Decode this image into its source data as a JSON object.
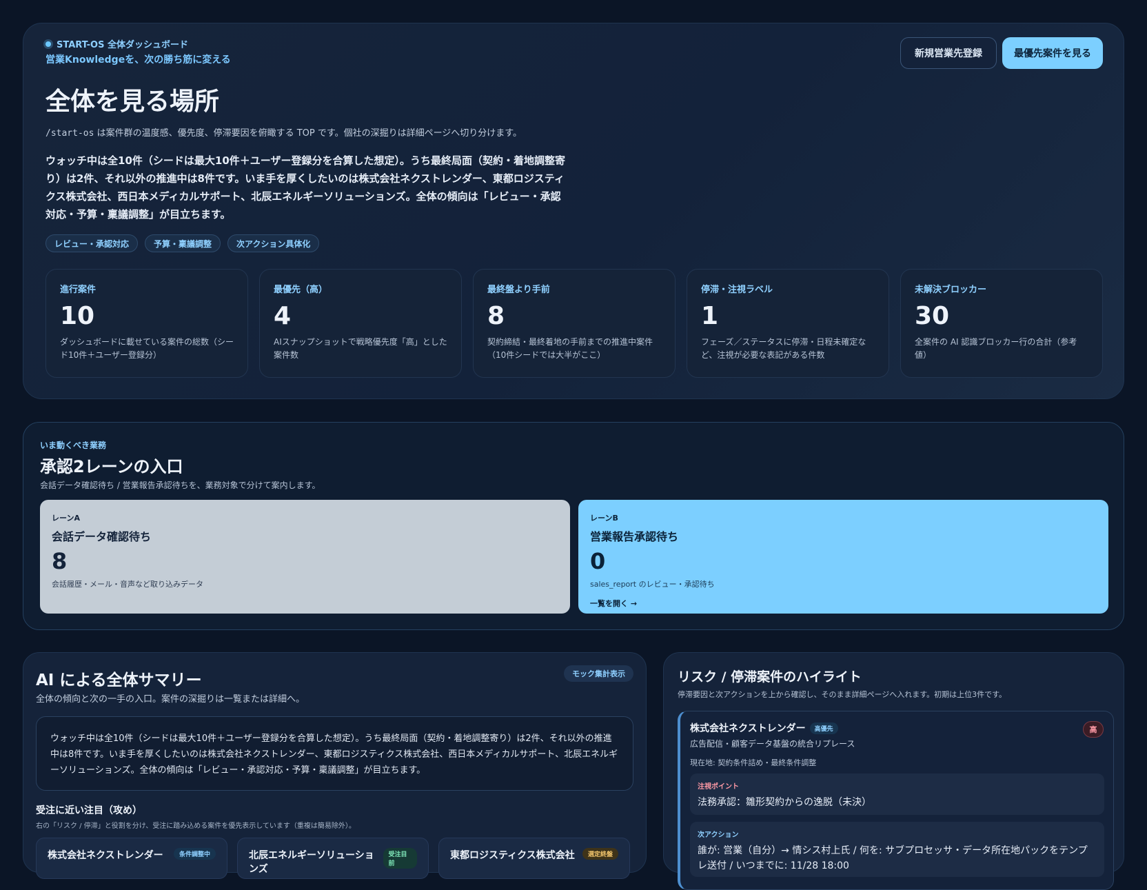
{
  "hero": {
    "eyebrow": "START-OS 全体ダッシュボード",
    "tagline": "営業Knowledgeを、次の勝ち筋に変える",
    "title": "全体を見る場所",
    "desc_code": "/start-os",
    "desc_rest": " は案件群の温度感、優先度、停滞要因を俯瞰する TOP です。個社の深掘りは詳細ページへ切り分けます。",
    "summary": "ウォッチ中は全10件（シードは最大10件＋ユーザー登録分を合算した想定）。うち最終局面（契約・着地調整寄り）は2件、それ以外の推進中は8件です。いま手を厚くしたいのは株式会社ネクストレンダー、東都ロジスティクス株式会社、西日本メディカルサポート、北辰エネルギーソリューションズ。全体の傾向は「レビュー・承認対応・予算・稟議調整」が目立ちます。",
    "chips": [
      "レビュー・承認対応",
      "予算・稟議調整",
      "次アクション具体化"
    ],
    "buttons": {
      "new_client": "新規営業先登録",
      "top_priority": "最優先案件を見る"
    },
    "stats": [
      {
        "label": "進行案件",
        "value": "10",
        "desc": "ダッシュボードに載せている案件の総数（シード10件＋ユーザー登録分）"
      },
      {
        "label": "最優先（高）",
        "value": "4",
        "desc": "AIスナップショットで戦略優先度「高」とした案件数"
      },
      {
        "label": "最終盤より手前",
        "value": "8",
        "desc": "契約締結・最終着地の手前までの推進中案件（10件シードでは大半がここ）"
      },
      {
        "label": "停滞・注視ラベル",
        "value": "1",
        "desc": "フェーズ／ステータスに停滞・日程未確定など、注視が必要な表記がある件数"
      },
      {
        "label": "未解決ブロッカー",
        "value": "30",
        "desc": "全案件の AI 認識ブロッカー行の合計（参考値）"
      }
    ]
  },
  "lanes": {
    "eyebrow": "いま動くべき業務",
    "title": "承認2レーンの入口",
    "desc": "会話データ確認待ち / 営業報告承認待ちを、業務対象で分けて案内します。",
    "lane_a": {
      "tag": "レーンA",
      "title": "会話データ確認待ち",
      "count": "8",
      "desc": "会話履歴・メール・音声など取り込みデータ"
    },
    "lane_b": {
      "tag": "レーンB",
      "title": "営業報告承認待ち",
      "count": "0",
      "desc": "sales_report のレビュー・承認待ち",
      "link": "一覧を開く →"
    }
  },
  "ai": {
    "title": "AI による全体サマリー",
    "sub": "全体の傾向と次の一手の入口。案件の深掘りは一覧または詳細へ。",
    "badge": "モック集計表示",
    "summary": "ウォッチ中は全10件（シードは最大10件＋ユーザー登録分を合算した想定）。うち最終局面（契約・着地調整寄り）は2件、それ以外の推進中は8件です。いま手を厚くしたいのは株式会社ネクストレンダー、東都ロジスティクス株式会社、西日本メディカルサポート、北辰エネルギーソリューションズ。全体の傾向は「レビュー・承認対応・予算・稟議調整」が目立ちます。",
    "section_title": "受注に近い注目（攻め）",
    "section_sub": "右の「リスク / 停滞」と役割を分け、受注に踏み込める案件を優先表示しています（重複は簡易除外）。",
    "cards": [
      {
        "name": "株式会社ネクストレンダー",
        "badge": "条件調整中"
      },
      {
        "name": "北辰エネルギーソリューションズ",
        "badge": "受注目前"
      },
      {
        "name": "東都ロジスティクス株式会社",
        "badge": "選定終盤"
      }
    ]
  },
  "risk": {
    "title": "リスク / 停滞案件のハイライト",
    "sub": "停滞要因と次アクションを上から確認し、そのまま詳細ページへ入れます。初期は上位3件です。",
    "card": {
      "name": "株式会社ネクストレンダー",
      "priority": "高優先",
      "level": "高",
      "subtitle": "広告配信・顧客データ基盤の統合リプレース",
      "location": "現在地: 契約条件詰め・最終条件調整",
      "watch_label": "注視ポイント",
      "watch_text": "法務承認：雛形契約からの逸脱（未決）",
      "next_label": "次アクション",
      "next_text": "誰が: 営業（自分）→ 情シス村上氏 / 何を: サブプロセッサ・データ所在地パックをテンプレ送付 / いつまでに: 11/28 18:00"
    }
  },
  "colors": {
    "accent": "#7ccfff",
    "background": "#0b1526",
    "danger": "#ff9aa6"
  }
}
